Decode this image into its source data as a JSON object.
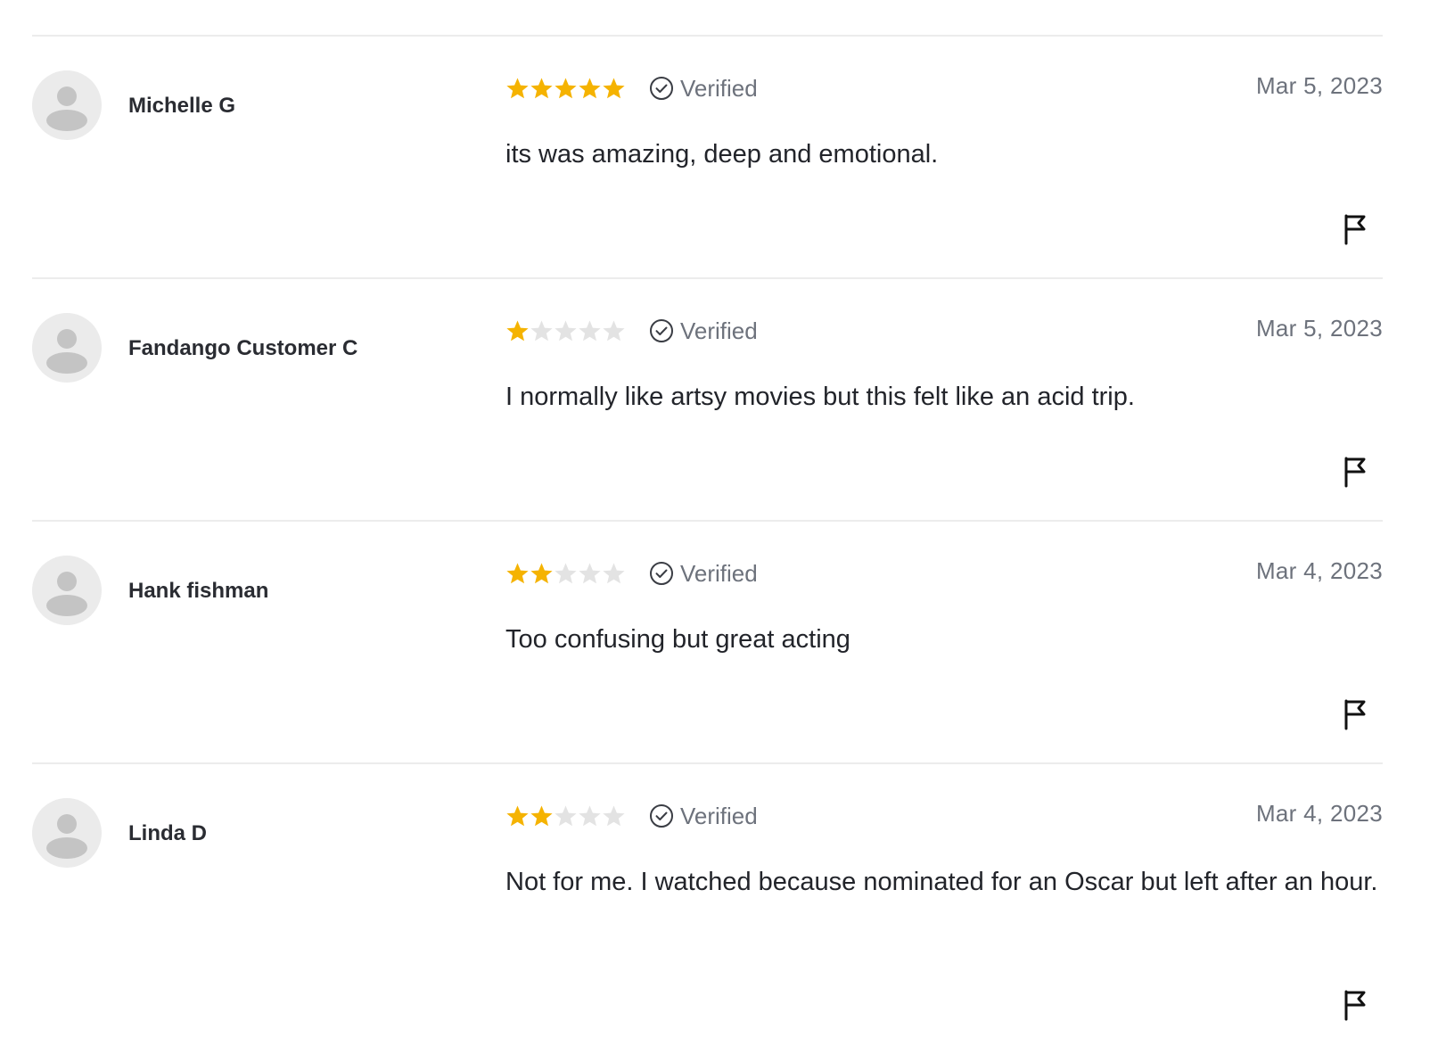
{
  "reviews": [
    {
      "name": "Michelle G",
      "rating": 5,
      "rating_max": 5,
      "verified_label": "Verified",
      "date": "Mar 5, 2023",
      "text": "its was amazing, deep and emotional."
    },
    {
      "name": "Fandango Customer C",
      "rating": 1,
      "rating_max": 5,
      "verified_label": "Verified",
      "date": "Mar 5, 2023",
      "text": "I normally like artsy movies but this felt like an acid trip."
    },
    {
      "name": "Hank fishman",
      "rating": 2,
      "rating_max": 5,
      "verified_label": "Verified",
      "date": "Mar 4, 2023",
      "text": "Too confusing but great acting"
    },
    {
      "name": "Linda D",
      "rating": 2,
      "rating_max": 5,
      "verified_label": "Verified",
      "date": "Mar 4, 2023",
      "text": "Not for me. I watched because nominated for an Oscar but left after an hour."
    }
  ],
  "icons": {
    "avatar": "default-avatar-icon",
    "star": "star-icon",
    "verified": "check-circle-icon",
    "flag": "flag-icon"
  },
  "colors": {
    "star_filled": "#f5b301",
    "star_empty": "#e3e3e3",
    "divider": "#ececec",
    "avatar_bg": "#ebebeb",
    "avatar_fg": "#c4c4c4",
    "muted_text": "#6d727c"
  }
}
